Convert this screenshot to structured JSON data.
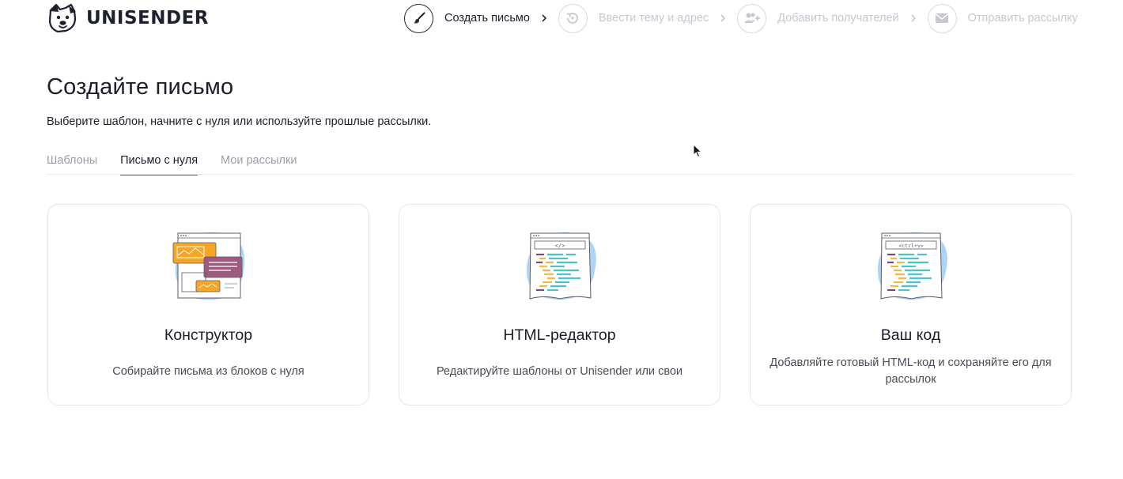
{
  "brand": {
    "name": "UNISENDER",
    "color": "#1e2030"
  },
  "steps": [
    {
      "label": "Создать письмо",
      "icon": "brush-icon",
      "active": true
    },
    {
      "label": "Ввести тему и адрес",
      "icon": "subject-icon",
      "active": false
    },
    {
      "label": "Добавить получателей",
      "icon": "add-user-icon",
      "active": false
    },
    {
      "label": "Отправить рассылку",
      "icon": "envelope-icon",
      "active": false
    }
  ],
  "page": {
    "title": "Создайте письмо",
    "subtitle": "Выберите шаблон, начните с нуля или используйте прошлые рассылки."
  },
  "tabs": [
    {
      "label": "Шаблоны",
      "active": false
    },
    {
      "label": "Письмо с нуля",
      "active": true
    },
    {
      "label": "Мои рассылки",
      "active": false
    }
  ],
  "cards": [
    {
      "title": "Конструктор",
      "description": "Собирайте письма из блоков с нуля",
      "illustration": "constructor-illustration-icon"
    },
    {
      "title": "HTML-редактор",
      "description": "Редактируйте шаблоны от Unisender или свои",
      "illustration": "html-editor-illustration-icon",
      "code_tag": "</>"
    },
    {
      "title": "Ваш код",
      "description": "Добавляйте готовый HTML-код и сохраняйте его для рассылок",
      "illustration": "paste-code-illustration-icon",
      "code_tag": "<ctrl+v>"
    }
  ],
  "colors": {
    "accent_blue": "#aed3f5",
    "orange": "#f6a623",
    "purple": "#9e5a7f",
    "code_teal": "#4cc2c9",
    "code_yellow": "#f4b942",
    "code_purple": "#7b4a7a"
  }
}
